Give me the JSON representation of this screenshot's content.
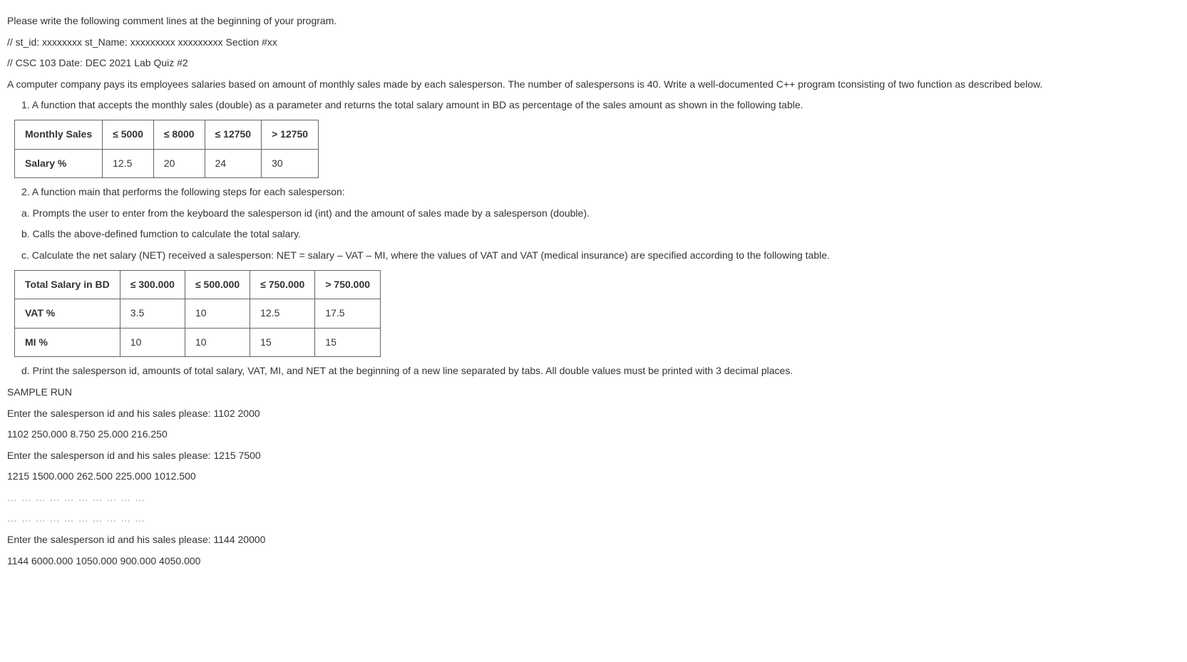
{
  "intro": {
    "line1": "Please write the following comment lines at the beginning of your program.",
    "comment1": "// st_id: xxxxxxxx st_Name: xxxxxxxxx xxxxxxxxx Section #xx",
    "comment2": "// CSC 103 Date: DEC 2021 Lab Quiz #2",
    "desc": "A computer company pays its employees salaries based on amount of monthly sales made by each salesperson. The number of salespersons is 40. Write a well-documented C++ program tconsisting of two function as described below."
  },
  "step1": "1. A function that accepts the monthly sales (double) as a parameter and returns the total salary amount in BD as percentage of the sales amount as shown in the following table.",
  "table1": {
    "r0c0": "Monthly Sales",
    "r0c1": "≤ 5000",
    "r0c2": "≤ 8000",
    "r0c3": "≤ 12750",
    "r0c4": "> 12750",
    "r1c0": "Salary %",
    "r1c1": "12.5",
    "r1c2": "20",
    "r1c3": "24",
    "r1c4": "30"
  },
  "step2": "2. A function main that performs the following steps for each salesperson:",
  "sub": {
    "a": "a. Prompts the user to enter from the keyboard the salesperson id (int) and the amount of sales made by a salesperson (double).",
    "b": "b. Calls the above-defined fumction to calculate the total salary.",
    "c": "c. Calculate the net salary (NET) received a salesperson: NET = salary – VAT – MI, where the values of VAT and VAT (medical insurance) are specified according to the following table.",
    "d": "d. Print the salesperson id, amounts of total salary, VAT, MI, and NET at the beginning of a new line separated by tabs. All double values must be printed with 3 decimal places."
  },
  "table2": {
    "r0c0": "Total Salary in BD",
    "r0c1": "≤ 300.000",
    "r0c2": "≤ 500.000",
    "r0c3": "≤ 750.000",
    "r0c4": "> 750.000",
    "r1c0": "VAT %",
    "r1c1": "3.5",
    "r1c2": "10",
    "r1c3": "12.5",
    "r1c4": "17.5",
    "r2c0": "MI %",
    "r2c1": "10",
    "r2c2": "10",
    "r2c3": "15",
    "r2c4": "15"
  },
  "sample": {
    "title": "SAMPLE RUN",
    "l1": "Enter the salesperson id and his sales please: 1102 2000",
    "l2": "1102 250.000 8.750 25.000 216.250",
    "l3": "Enter the salesperson id and his sales please: 1215 7500",
    "l4": "1215 1500.000 262.500 225.000 1012.500",
    "dots1": "… … … … … … … … … …",
    "dots2": "… … … … … … … … … …",
    "l5": "Enter the salesperson id and his sales please: 1144 20000",
    "l6": "1144 6000.000 1050.000 900.000 4050.000"
  }
}
